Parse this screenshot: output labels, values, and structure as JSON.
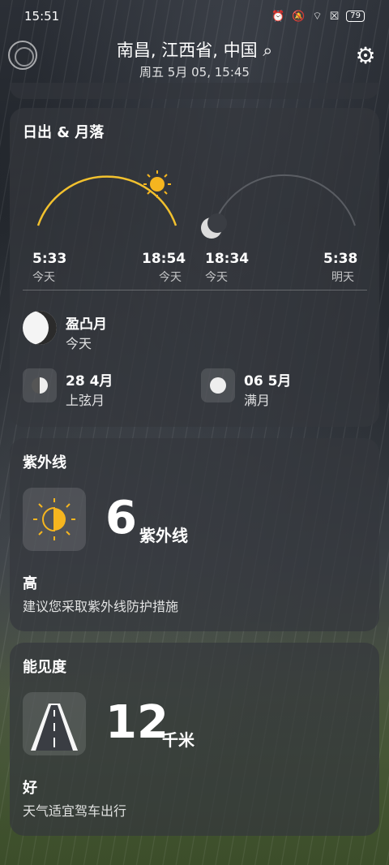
{
  "status_bar": {
    "time": "15:51",
    "battery": "79"
  },
  "header": {
    "location": "南昌, 江西省, 中国",
    "search_icon": "⌕",
    "datetime": "周五 5月 05, 15:45"
  },
  "sun_moon": {
    "title": "日出 & 月落",
    "sunrise": "5:33",
    "sunrise_day": "今天",
    "sunset": "18:54",
    "sunset_day": "今天",
    "moonrise": "18:34",
    "moonrise_day": "今天",
    "moonset": "5:38",
    "moonset_day": "明天",
    "current_phase": "盈凸月",
    "current_phase_day": "今天",
    "next_phase_1": {
      "date": "28 4月",
      "name": "上弦月"
    },
    "next_phase_2": {
      "date": "06 5月",
      "name": "满月"
    }
  },
  "uv": {
    "title": "紫外线",
    "value": "6",
    "unit": "紫外线",
    "level": "高",
    "advice": "建议您采取紫外线防护措施"
  },
  "visibility": {
    "title": "能见度",
    "value": "12",
    "unit": "千米",
    "level": "好",
    "advice": "天气适宜驾车出行"
  },
  "colors": {
    "sun_arc": "#f2c12e",
    "sun": "#f5b51f",
    "moon_arc": "#5a5d63"
  },
  "icons": [
    "alarm-icon",
    "mute-icon",
    "wifi-icon",
    "sim-icon",
    "battery-icon",
    "radar-icon",
    "search-icon",
    "gear-icon",
    "sun-icon",
    "moon-icon",
    "uv-icon",
    "road-icon"
  ]
}
